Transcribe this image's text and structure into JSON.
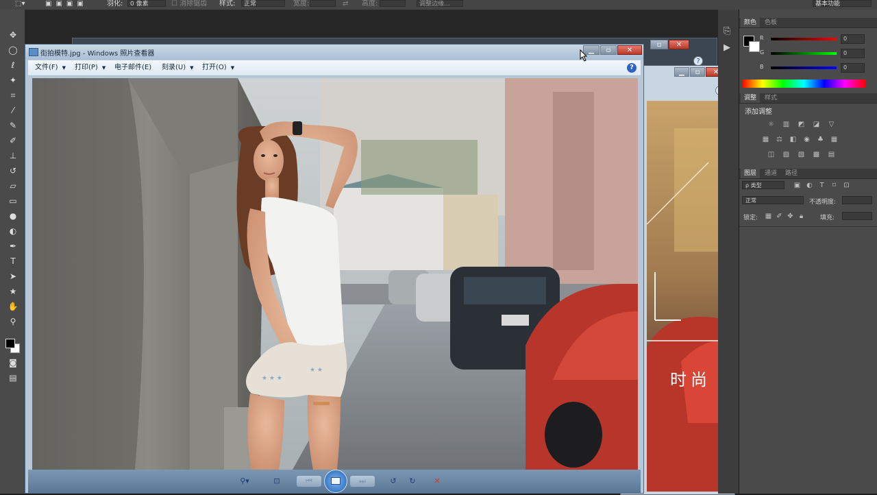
{
  "options_bar": {
    "feather_label": "羽化:",
    "feather_value": "0 像素",
    "antialias_label": "消除锯齿",
    "style_label": "样式:",
    "style_value": "正常",
    "width_label": "宽度:",
    "height_label": "高度:",
    "refine_edge": "调整边缘...",
    "workspace": "基本功能"
  },
  "viewer": {
    "title": "街拍模特.jpg - Windows 照片查看器",
    "menu": [
      {
        "label": "文件(F)"
      },
      {
        "label": "打印(P)"
      },
      {
        "label": "电子邮件(E)"
      },
      {
        "label": "刻录(U)"
      },
      {
        "label": "打开(O)"
      }
    ],
    "help": "?"
  },
  "background_doc": {
    "overlay_text": "时尚"
  },
  "color_panel": {
    "tabs": [
      "颜色",
      "色板"
    ],
    "channels": [
      {
        "label": "R",
        "value": "0",
        "color": "#e02020"
      },
      {
        "label": "G",
        "value": "0",
        "color": "#20c020"
      },
      {
        "label": "B",
        "value": "0",
        "color": "#2040e0"
      }
    ]
  },
  "adjust_panel": {
    "tabs": [
      "调整",
      "样式"
    ],
    "title": "添加调整"
  },
  "layers_panel": {
    "tabs": [
      "图层",
      "通道",
      "路径"
    ],
    "kind_label": "ρ 类型",
    "blend_mode": "正常",
    "opacity_label": "不透明度:",
    "lock_label": "锁定:",
    "fill_label": "填充:"
  },
  "colors": {
    "ps_bg": "#4a4a4a",
    "viewer_chrome": "#b7c7d8",
    "close_red": "#c8402f"
  }
}
